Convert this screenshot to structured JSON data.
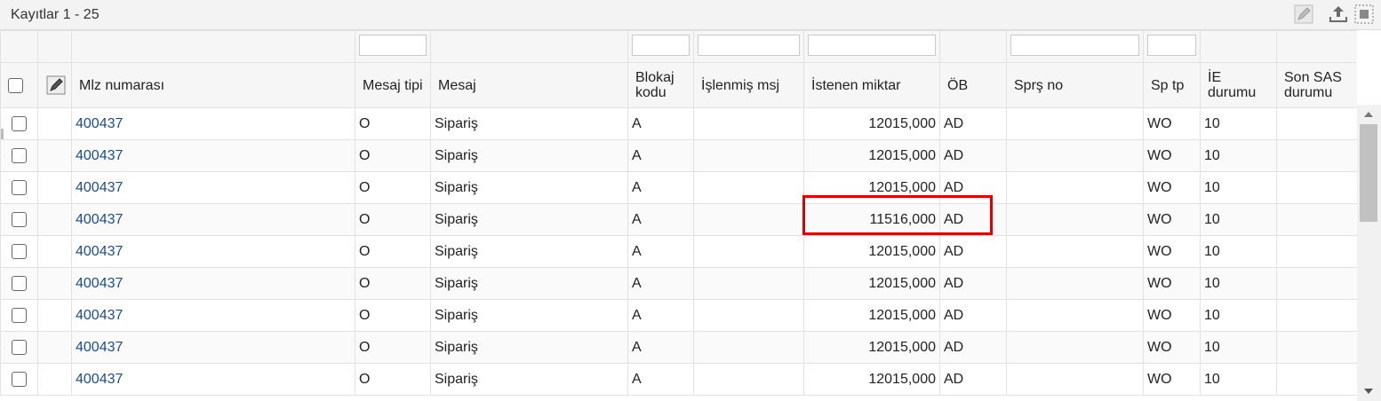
{
  "toolbar": {
    "title": "Kayıtlar 1 - 25",
    "icons": [
      "edit-icon",
      "export-upload-icon",
      "fit-columns-icon"
    ]
  },
  "columns": [
    {
      "label": "Mlz numarası",
      "filter": false
    },
    {
      "label": "Mesaj tipi",
      "filter": true
    },
    {
      "label": "Mesaj",
      "filter": false
    },
    {
      "label": "Blokaj kodu",
      "filter": true
    },
    {
      "label": "İşlenmiş msj",
      "filter": true
    },
    {
      "label": "İstenen miktar",
      "filter": true
    },
    {
      "label": "ÖB",
      "filter": false
    },
    {
      "label": "Sprş no",
      "filter": true
    },
    {
      "label": "Sp tp",
      "filter": true
    },
    {
      "label": "İE durumu",
      "filter": false
    },
    {
      "label": "Son SAS durumu",
      "filter": false
    }
  ],
  "rows": [
    {
      "mlz": "400437",
      "tip": "O",
      "mesaj": "Sipariş",
      "blokaj": "A",
      "islenmis": "",
      "miktar": "12015,000",
      "ob": "AD",
      "sprs": "",
      "sptp": "WO",
      "ie": "10",
      "sas": ""
    },
    {
      "mlz": "400437",
      "tip": "O",
      "mesaj": "Sipariş",
      "blokaj": "A",
      "islenmis": "",
      "miktar": "12015,000",
      "ob": "AD",
      "sprs": "",
      "sptp": "WO",
      "ie": "10",
      "sas": ""
    },
    {
      "mlz": "400437",
      "tip": "O",
      "mesaj": "Sipariş",
      "blokaj": "A",
      "islenmis": "",
      "miktar": "12015,000",
      "ob": "AD",
      "sprs": "",
      "sptp": "WO",
      "ie": "10",
      "sas": ""
    },
    {
      "mlz": "400437",
      "tip": "O",
      "mesaj": "Sipariş",
      "blokaj": "A",
      "islenmis": "",
      "miktar": "11516,000",
      "ob": "AD",
      "sprs": "",
      "sptp": "WO",
      "ie": "10",
      "sas": ""
    },
    {
      "mlz": "400437",
      "tip": "O",
      "mesaj": "Sipariş",
      "blokaj": "A",
      "islenmis": "",
      "miktar": "12015,000",
      "ob": "AD",
      "sprs": "",
      "sptp": "WO",
      "ie": "10",
      "sas": ""
    },
    {
      "mlz": "400437",
      "tip": "O",
      "mesaj": "Sipariş",
      "blokaj": "A",
      "islenmis": "",
      "miktar": "12015,000",
      "ob": "AD",
      "sprs": "",
      "sptp": "WO",
      "ie": "10",
      "sas": ""
    },
    {
      "mlz": "400437",
      "tip": "O",
      "mesaj": "Sipariş",
      "blokaj": "A",
      "islenmis": "",
      "miktar": "12015,000",
      "ob": "AD",
      "sprs": "",
      "sptp": "WO",
      "ie": "10",
      "sas": ""
    },
    {
      "mlz": "400437",
      "tip": "O",
      "mesaj": "Sipariş",
      "blokaj": "A",
      "islenmis": "",
      "miktar": "12015,000",
      "ob": "AD",
      "sprs": "",
      "sptp": "WO",
      "ie": "10",
      "sas": ""
    },
    {
      "mlz": "400437",
      "tip": "O",
      "mesaj": "Sipariş",
      "blokaj": "A",
      "islenmis": "",
      "miktar": "12015,000",
      "ob": "AD",
      "sprs": "",
      "sptp": "WO",
      "ie": "10",
      "sas": ""
    }
  ],
  "colors": {
    "link": "#1a4d8f",
    "highlight": "#e00000",
    "header_bg": "#f6f6f6"
  }
}
